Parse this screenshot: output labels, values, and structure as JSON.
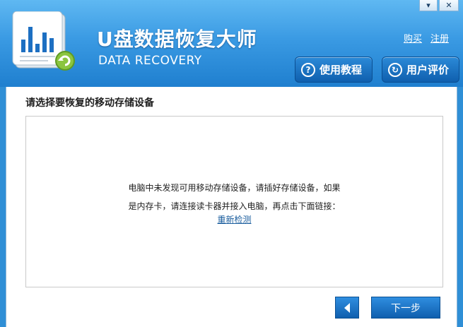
{
  "window": {
    "controls": {
      "minimize": "▾",
      "close": "✕"
    }
  },
  "header": {
    "title": "U盘数据恢复大师",
    "subtitle": "DATA RECOVERY",
    "links": {
      "buy": "购买",
      "register": "注册"
    },
    "buttons": {
      "tutorial": {
        "label": "使用教程",
        "icon": "question-icon"
      },
      "review": {
        "label": "用户评价",
        "icon": "recycle-icon"
      }
    }
  },
  "main": {
    "prompt": "请选择要恢复的移动存储设备",
    "message_line1": "电脑中未发现可用移动存储设备，请插好存储设备，如果",
    "message_line2": "是内存卡，请连接读卡器并接入电脑，再点击下面链接：",
    "recheck_link": "重新检测"
  },
  "footer": {
    "next_label": "下一步",
    "back_icon": "back-arrow-icon"
  },
  "colors": {
    "header_top": "#5fb8f2",
    "header_bottom": "#1f7fcf",
    "button_blue": "#0f5fae",
    "link_blue": "#1b5e9e"
  }
}
